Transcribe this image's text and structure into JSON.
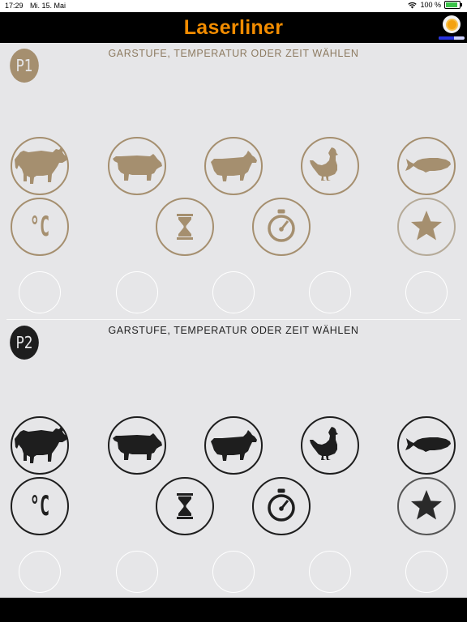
{
  "status_bar": {
    "time": "17:29",
    "date": "Mi. 15. Mai",
    "battery": "100 %",
    "battery_level": 1.0
  },
  "header": {
    "title": "Laserliner",
    "connection_progress": 0.6
  },
  "colors": {
    "p1_accent": "#a58f6f",
    "p2_accent": "#1e1e1e",
    "brand_orange": "#f28c00",
    "background": "#e6e6e8"
  },
  "probes": [
    {
      "badge": "P1",
      "title": "GARSTUFE, TEMPERATUR ODER ZEIT WÄHLEN",
      "meat_buttons": [
        "beef-icon",
        "pork-icon",
        "veal-icon",
        "poultry-icon",
        "fish-icon"
      ],
      "mode_buttons": [
        "celsius-icon",
        "hourglass-icon",
        "stopwatch-icon",
        "star-icon"
      ],
      "empty_slots": 5
    },
    {
      "badge": "P2",
      "title": "GARSTUFE, TEMPERATUR ODER ZEIT WÄHLEN",
      "meat_buttons": [
        "beef-icon",
        "pork-icon",
        "veal-icon",
        "poultry-icon",
        "fish-icon"
      ],
      "mode_buttons": [
        "celsius-icon",
        "hourglass-icon",
        "stopwatch-icon",
        "star-icon"
      ],
      "empty_slots": 5
    }
  ],
  "celsius_label": "°C"
}
